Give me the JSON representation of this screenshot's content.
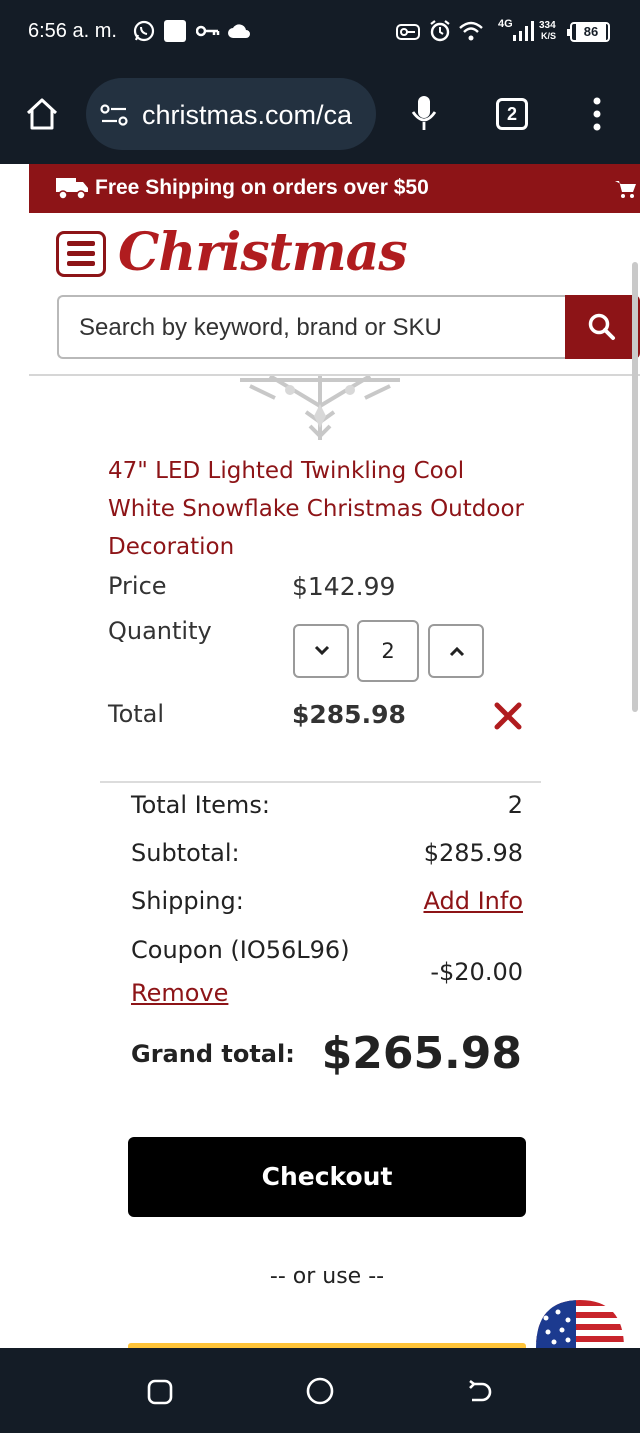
{
  "status_bar": {
    "time": "6:56 a. m.",
    "network": "4G",
    "speed_value": "334",
    "speed_unit": "K/S",
    "battery": "86"
  },
  "browser": {
    "url": "christmas.com/ca",
    "tab_count": "2"
  },
  "promo_banner": {
    "text": "Free Shipping on orders over $50"
  },
  "site": {
    "logo_text": "Christmas",
    "search_placeholder": "Search by keyword, brand or SKU"
  },
  "cart_item": {
    "title": "47\" LED Lighted Twinkling Cool White Snowflake Christmas Outdoor Decoration",
    "price_label": "Price",
    "price": "$142.99",
    "quantity_label": "Quantity",
    "quantity": "2",
    "total_label": "Total",
    "total": "$285.98"
  },
  "summary": {
    "total_items_label": "Total Items:",
    "total_items": "2",
    "subtotal_label": "Subtotal:",
    "subtotal": "$285.98",
    "shipping_label": "Shipping:",
    "shipping_link": "Add Info",
    "coupon_label": "Coupon (IO56L96)",
    "coupon_value": "-$20.00",
    "coupon_remove": "Remove",
    "grand_total_label": "Grand total:",
    "grand_total": "$265.98"
  },
  "actions": {
    "checkout": "Checkout",
    "or_use": "-- or use --"
  },
  "colors": {
    "brand_red": "#8d1417",
    "dark_bar": "#141c26",
    "paypal_yellow": "#ffc439"
  }
}
